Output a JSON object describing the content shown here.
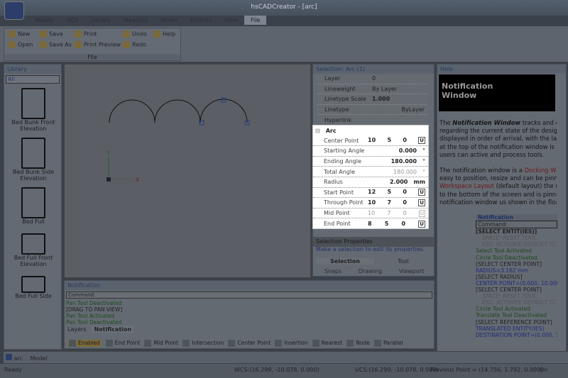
{
  "app": {
    "title": "hsCADCreator - [arc]"
  },
  "ribbon": {
    "tabs": [
      "Modify",
      "UCS",
      "Library",
      "Measure",
      "Model",
      "Entities",
      "View",
      "File"
    ],
    "active_tab": "File",
    "group_label": "File",
    "buttons": {
      "new": "New",
      "open": "Open",
      "save": "Save",
      "save_as": "Save As",
      "print": "Print",
      "print_preview": "Print Preview",
      "undo": "Undo",
      "redo": "Redo",
      "help": "Help"
    }
  },
  "library": {
    "title": "Library",
    "filter": "All",
    "items": [
      "Bed Bunk Front Elevation",
      "Bed Bunk Side Elevation",
      "Bed Full",
      "Bed Full Front Elevation",
      "Bed Full Side"
    ]
  },
  "selection": {
    "title": "Selection: Arc (1)",
    "general": [
      {
        "label": "Layer",
        "value": "0"
      },
      {
        "label": "Lineweight",
        "value": "By Layer"
      },
      {
        "label": "Linetype Scale",
        "value": "1.000"
      },
      {
        "label": "Linetype",
        "value": "ByLayer"
      },
      {
        "label": "Hyperlink",
        "value": ""
      }
    ],
    "section": "Arc",
    "arc": {
      "center_point": {
        "label": "Center Point",
        "x": "10",
        "y": "5",
        "z": "0"
      },
      "starting_angle": {
        "label": "Starting Angle",
        "value": "0.000",
        "unit": "°"
      },
      "ending_angle": {
        "label": "Ending Angle",
        "value": "180.000",
        "unit": "°"
      },
      "total_angle": {
        "label": "Total Angle",
        "value": "180.000",
        "unit": "°"
      },
      "radius": {
        "label": "Radius",
        "value": "2.000",
        "unit": "mm"
      },
      "start_point": {
        "label": "Start Point",
        "x": "12",
        "y": "5",
        "z": "0"
      },
      "through_point": {
        "label": "Through Point",
        "x": "10",
        "y": "7",
        "z": "0"
      },
      "mid_point": {
        "label": "Mid Point",
        "x": "10",
        "y": "7",
        "z": "0"
      },
      "end_point": {
        "label": "End Point",
        "x": "8",
        "y": "5",
        "z": "0"
      },
      "u_label": "U"
    },
    "footer_title": "Selection Properties",
    "footer_text": "Make a selection to edit its properties.",
    "tabs": [
      "Selection",
      "Tool"
    ],
    "subtabs": [
      "Snaps",
      "Drawing",
      "Viewport"
    ]
  },
  "help": {
    "title": "Help",
    "hero": "Notification Window",
    "p1_prefix": "The ",
    "p1_bold": "Notification Window",
    "p1_lines": [
      " tracks and dis",
      "regarding the current state of the design",
      "displayed in order of arrival, with the lates",
      "at the top of the notification window is the",
      "users can active and process tools."
    ],
    "p2_a": "The notification window is a ",
    "p2_link1": "Docking Wir",
    "p2_b": "easy to position, resize and can be pinne",
    "p2_link2": "Workspace Layout",
    "p2_c": " (default layout) the n",
    "p2_d": "to the bottom of the screen and is pinnec",
    "p2_e": "notification window us shown in the floati",
    "embedded_title": "Notification",
    "embedded_command": "Command:",
    "embedded_log": [
      {
        "t": "[SELECT ENTIT(IES)]",
        "c": "bold"
      },
      {
        "t": "SPACE: RESET TOOL",
        "c": "i"
      },
      {
        "t": "ESC: ACTIVATE DEFAULT TC",
        "c": "i"
      },
      {
        "t": "Select Tool Activated",
        "c": "g"
      },
      {
        "t": "Circle Tool Deactivated",
        "c": "g"
      },
      {
        "t": "[SELECT CENTER POINT]",
        "c": ""
      },
      {
        "t": "RADIUS=3.162 mm",
        "c": "b"
      },
      {
        "t": "[SELECT RADIUS]",
        "c": ""
      },
      {
        "t": "CENTER POINT=(0.000, 10.000,",
        "c": "b"
      },
      {
        "t": "[SELECT CENTER POINT]",
        "c": ""
      },
      {
        "t": "SPACE: RESET TOOL",
        "c": "i"
      },
      {
        "t": "ESC: ACTIVATE DEFAULT TC",
        "c": "i"
      },
      {
        "t": "Circle Tool Activated",
        "c": "g"
      },
      {
        "t": "Translate Tool Deactivated",
        "c": "g"
      },
      {
        "t": "[SELECT REFERENCE POINT]",
        "c": ""
      },
      {
        "t": "TRANSLATED ENTITY(IES)",
        "c": "b"
      },
      {
        "t": "DESTINATION POINT=(0.000, 1(",
        "c": "b"
      }
    ]
  },
  "notification": {
    "title": "Notification",
    "command_label": "Command:",
    "log": [
      {
        "t": "Pan Tool Deactivated",
        "c": "g"
      },
      {
        "t": "[DRAG TO PAN VIEW]",
        "c": ""
      },
      {
        "t": "Pan Tool Activated",
        "c": "g"
      },
      {
        "t": "Pan Tool Deactivated",
        "c": "g"
      }
    ],
    "tabs": [
      "Layers",
      "Notification"
    ],
    "active_tab": "Notification"
  },
  "snaps": [
    "Enabled",
    "End Point",
    "Mid Point",
    "Intersection",
    "Center Point",
    "Insertion",
    "Nearest",
    "Node",
    "Parallel"
  ],
  "doc_tabs": {
    "doc": "arc",
    "layout": "Model"
  },
  "status": {
    "ready": "Ready",
    "wcs": "WCS:(16.299, -10.078, 0.000)",
    "ucs": "UCS:(16.299, -10.078, 0.000)",
    "previous": "Previous Point = (14.756, 1.792, 0.000)",
    "mode": "On"
  },
  "canvas": {
    "axis_x": "X",
    "axis_y": "Y"
  }
}
